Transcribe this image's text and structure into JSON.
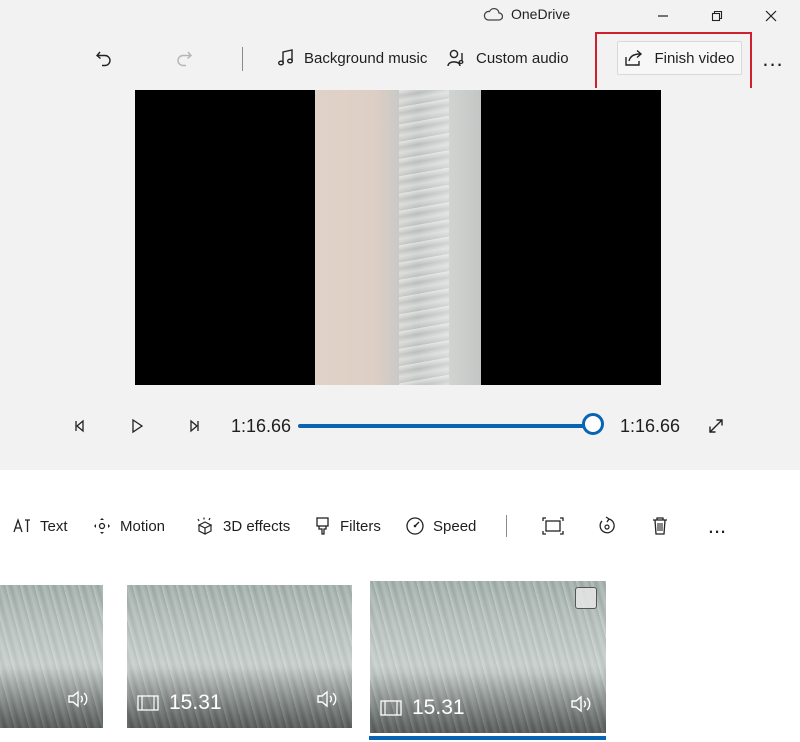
{
  "window": {
    "title": "OneDrive"
  },
  "toolbar": {
    "background_music_label": "Background music",
    "custom_audio_label": "Custom audio",
    "finish_video_label": "Finish video",
    "more_label": "..."
  },
  "playback": {
    "current_time": "1:16.66",
    "total_time": "1:16.66",
    "progress": 1.0
  },
  "storyboard_toolbar": {
    "text_label": "Text",
    "motion_label": "Motion",
    "effects_label": "3D effects",
    "filters_label": "Filters",
    "speed_label": "Speed",
    "more_label": "..."
  },
  "clips": [
    {
      "duration": "",
      "selected": false
    },
    {
      "duration": "15.31",
      "selected": false
    },
    {
      "duration": "15.31",
      "selected": true
    }
  ],
  "colors": {
    "accent": "#0a64b4",
    "highlight": "#d0202f"
  }
}
